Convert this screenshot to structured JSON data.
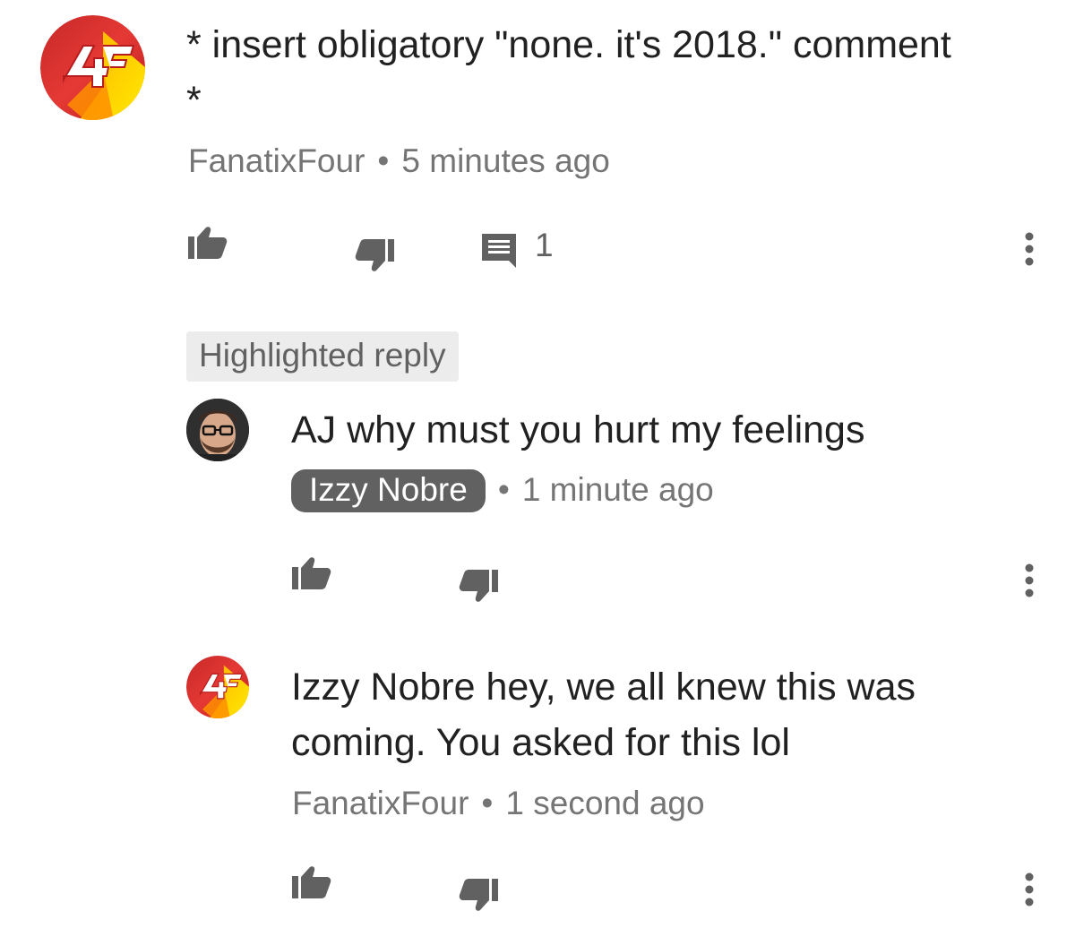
{
  "comments": [
    {
      "author": "FanatixFour",
      "avatar_badge": "4F",
      "text_line1": "* insert obligatory \"none. it's 2018.\" comment",
      "text_line2": "*",
      "separator": "•",
      "time": "5 minutes ago",
      "reply_count": "1",
      "icons": [
        "thumb-up-icon",
        "thumb-down-icon",
        "comment-icon",
        "more-vert-icon"
      ]
    }
  ],
  "highlighted_label": "Highlighted reply",
  "replies": [
    {
      "author": "Izzy Nobre",
      "author_is_creator": true,
      "text": "AJ why must you hurt my feelings",
      "separator": "•",
      "time": "1 minute ago",
      "icons": [
        "thumb-up-icon",
        "thumb-down-icon",
        "more-vert-icon"
      ]
    },
    {
      "author": "FanatixFour",
      "avatar_badge": "4F",
      "text_line1": "Izzy Nobre hey, we all knew this was",
      "text_line2": "coming. You asked for this lol",
      "separator": "•",
      "time": "1 second ago",
      "icons": [
        "thumb-up-icon",
        "thumb-down-icon",
        "more-vert-icon"
      ]
    }
  ],
  "colors": {
    "logo_red": "#d32f2f",
    "logo_orange": "#ff8f00",
    "logo_yellow": "#ffd600",
    "creator_pill": "#616161",
    "meta_gray": "#757575",
    "icon_gray": "#616161"
  }
}
